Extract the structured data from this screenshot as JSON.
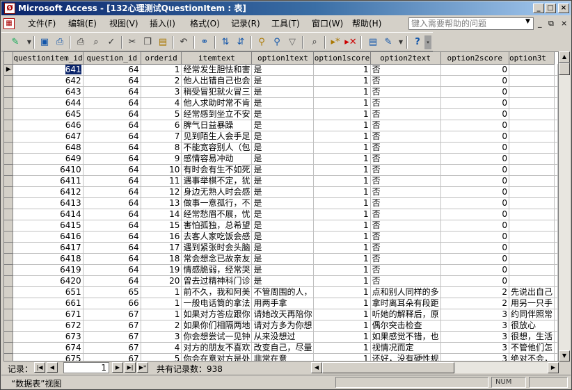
{
  "window": {
    "title": "Microsoft Access - [132心理测试QuestionItem : 表]",
    "app_icon": "access-key-icon"
  },
  "menu": {
    "items": [
      "文件(F)",
      "编辑(E)",
      "视图(V)",
      "插入(I)",
      "格式(O)",
      "记录(R)",
      "工具(T)",
      "窗口(W)",
      "帮助(H)"
    ],
    "help_placeholder": "键入需要帮助的问题"
  },
  "toolbar": {
    "icons": [
      "design-view-icon",
      "save-icon",
      "print-setup-icon",
      "print-icon",
      "print-preview-icon",
      "spelling-icon",
      "cut-icon",
      "copy-icon",
      "paste-icon",
      "undo-icon",
      "insert-hyperlink-icon",
      "sort-ascending-icon",
      "sort-descending-icon",
      "filter-by-selection-icon",
      "filter-by-form-icon",
      "apply-filter-icon",
      "find-icon",
      "new-record-icon",
      "delete-record-icon",
      "database-window-icon",
      "new-object-icon",
      "help-icon"
    ]
  },
  "table": {
    "columns": [
      "questionitem_id",
      "question_id",
      "orderid",
      "itemtext",
      "option1text",
      "option1score",
      "option2text",
      "option2score",
      "option3t"
    ],
    "rows": [
      [
        "641",
        "64",
        "1",
        "经常发生胆怯和害",
        "是",
        "1",
        "否",
        "0",
        ""
      ],
      [
        "642",
        "64",
        "2",
        "他人出错自己也会",
        "是",
        "1",
        "否",
        "0",
        ""
      ],
      [
        "643",
        "64",
        "3",
        "稍受冒犯就火冒三",
        "是",
        "1",
        "否",
        "0",
        ""
      ],
      [
        "644",
        "64",
        "4",
        "他人求助时常不肯",
        "是",
        "1",
        "否",
        "0",
        ""
      ],
      [
        "645",
        "64",
        "5",
        "经常感到坐立不安",
        "是",
        "1",
        "否",
        "0",
        ""
      ],
      [
        "646",
        "64",
        "6",
        "脾气日益暴躁",
        "是",
        "1",
        "否",
        "0",
        ""
      ],
      [
        "647",
        "64",
        "7",
        "见到陌生人会手足",
        "是",
        "1",
        "否",
        "0",
        ""
      ],
      [
        "648",
        "64",
        "8",
        "不能宽容别人（包",
        "是",
        "1",
        "否",
        "0",
        ""
      ],
      [
        "649",
        "64",
        "9",
        "感情容易冲动",
        "是",
        "1",
        "否",
        "0",
        ""
      ],
      [
        "6410",
        "64",
        "10",
        "有时会有生不如死",
        "是",
        "1",
        "否",
        "0",
        ""
      ],
      [
        "6411",
        "64",
        "11",
        "遇事举棋不定，犹",
        "是",
        "1",
        "否",
        "0",
        ""
      ],
      [
        "6412",
        "64",
        "12",
        "身边无熟人时会感",
        "是",
        "1",
        "否",
        "0",
        ""
      ],
      [
        "6413",
        "64",
        "13",
        "做事一意孤行，不",
        "是",
        "1",
        "否",
        "0",
        ""
      ],
      [
        "6414",
        "64",
        "14",
        "经常愁眉不展，忧",
        "是",
        "1",
        "否",
        "0",
        ""
      ],
      [
        "6415",
        "64",
        "15",
        "害怕孤独，总希望",
        "是",
        "1",
        "否",
        "0",
        ""
      ],
      [
        "6416",
        "64",
        "16",
        "去客人家吃饭会感",
        "是",
        "1",
        "否",
        "0",
        ""
      ],
      [
        "6417",
        "64",
        "17",
        "遇到紧张时会头脑",
        "是",
        "1",
        "否",
        "0",
        ""
      ],
      [
        "6418",
        "64",
        "18",
        "常会想念已故亲友",
        "是",
        "1",
        "否",
        "0",
        ""
      ],
      [
        "6419",
        "64",
        "19",
        "情感脆弱，经常哭",
        "是",
        "1",
        "否",
        "0",
        ""
      ],
      [
        "6420",
        "64",
        "20",
        "曾去过精神科门诊",
        "是",
        "1",
        "否",
        "0",
        ""
      ],
      [
        "651",
        "65",
        "1",
        "前不久，我和阿美",
        "不管周围的人，",
        "1",
        "点和别人同样的多",
        "2",
        "先说出自己"
      ],
      [
        "661",
        "66",
        "1",
        "一般电话筒的拿法",
        "用两手拿",
        "1",
        "拿时离耳朵有段距",
        "2",
        "用另一只手"
      ],
      [
        "671",
        "67",
        "1",
        "如果对方答应跟你",
        "请她改天再陪你",
        "1",
        "听她的解释后，原",
        "3",
        "约同伴照常"
      ],
      [
        "672",
        "67",
        "2",
        "如果你们相隔两地",
        "请对方多为你想",
        "1",
        "偶尔突击检查",
        "3",
        "很放心"
      ],
      [
        "673",
        "67",
        "3",
        "你会想尝试一见钟",
        "从来没想过",
        "1",
        "如果感觉不错，也",
        "3",
        "很想，生活"
      ],
      [
        "674",
        "67",
        "4",
        "对方的朋友不喜欢",
        "改变自己，尽量",
        "1",
        "视情况而定",
        "3",
        "不管他们怎"
      ],
      [
        "675",
        "67",
        "5",
        "你会在意对方是处",
        "非常在意",
        "1",
        "还好，没有硬性规",
        "3",
        "绝对不会，"
      ]
    ]
  },
  "navigation": {
    "record_label": "记录：",
    "current_record": "1",
    "total_label": "共有记录数：938"
  },
  "status": {
    "view": "“数据表”视图",
    "num": "NUM"
  }
}
